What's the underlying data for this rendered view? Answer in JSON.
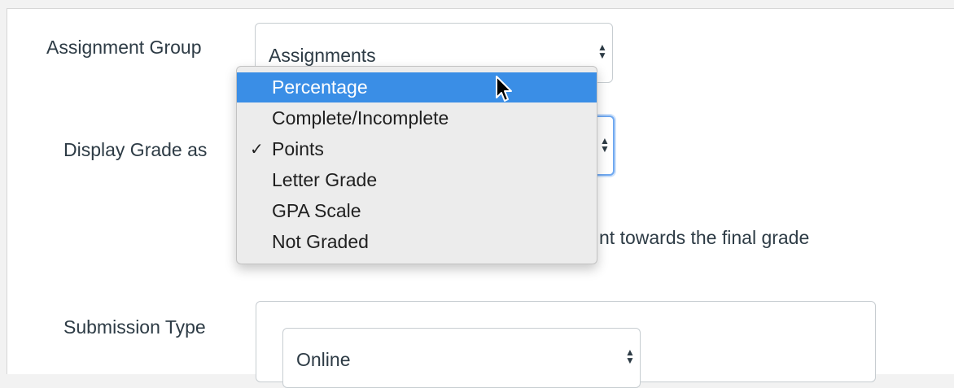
{
  "assignment_group": {
    "label": "Assignment Group",
    "selected": "Assignments"
  },
  "display_grade": {
    "label": "Display Grade as",
    "options": [
      {
        "label": "Percentage",
        "highlighted": true,
        "checked": false
      },
      {
        "label": "Complete/Incomplete",
        "highlighted": false,
        "checked": false
      },
      {
        "label": "Points",
        "highlighted": false,
        "checked": true
      },
      {
        "label": "Letter Grade",
        "highlighted": false,
        "checked": false
      },
      {
        "label": "GPA Scale",
        "highlighted": false,
        "checked": false
      },
      {
        "label": "Not Graded",
        "highlighted": false,
        "checked": false
      }
    ],
    "check_glyph": "✓",
    "partial_text": "nt towards the final grade"
  },
  "submission_type": {
    "label": "Submission Type",
    "selected": "Online"
  },
  "colors": {
    "highlight": "#3a8ee6",
    "focus_ring": "#6fa8f0",
    "text": "#2d3b45"
  },
  "icons": {
    "select_arrows": "updown-chevron-icon",
    "cursor": "mouse-pointer-icon"
  }
}
